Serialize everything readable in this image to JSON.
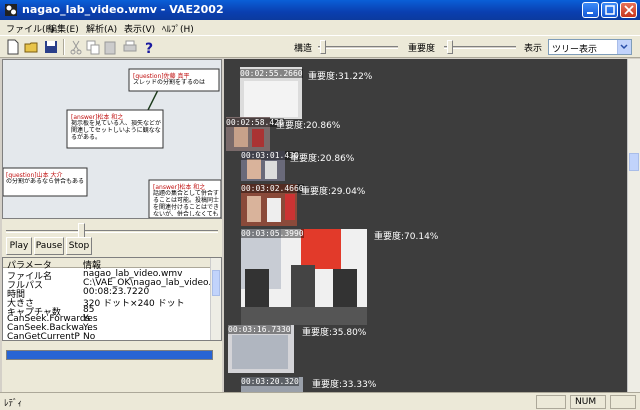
{
  "window": {
    "title": "nagao_lab_video.wmv - VAE2002"
  },
  "menu": [
    "ファイル(F)",
    "編集(E)",
    "解析(A)",
    "表示(V)",
    "ﾍﾙﾌﾟ(H)"
  ],
  "toolbar": {
    "structure_label": "構造",
    "importance_label": "重要度",
    "display_label": "表示",
    "display_value": "ツリー表示"
  },
  "player": {
    "play": "Play",
    "pause": "Pause",
    "stop": "Stop",
    "notes": [
      {
        "header": "[question]佐藤 真平",
        "body": "スレッドの分割をするのは"
      },
      {
        "header": "[answer]松本 和之",
        "body": "掲示板を見ている人、損失などが関連してセットしいように観ななるがある。"
      },
      {
        "header": "[question]山本 大介",
        "body": "の分割があるなら併合もある"
      },
      {
        "header": "[answer]松本 和之",
        "body": "話題の集合として併合することは可能。投稿同士を関連付けることはできないが、併合しなくても処理"
      }
    ]
  },
  "properties": {
    "header": [
      "パラメータ",
      "情報"
    ],
    "rows": [
      [
        "ファイル名",
        "nagao_lab_video.wmv"
      ],
      [
        "フルパス",
        "C:\\VAE_OK\\nagao_lab_video.w..."
      ],
      [
        "時間",
        "00:08:23.7220"
      ],
      [
        "大きさ",
        "320 ドット×240 ドット"
      ],
      [
        "キャプチャ数",
        "85"
      ],
      [
        "CanSeek.Forwards",
        "Yes"
      ],
      [
        "CanSeek.Backwa...",
        "Yes"
      ],
      [
        "CanGetCurrentP",
        "No"
      ]
    ],
    "progress": 1.0
  },
  "scenes": [
    {
      "time": "00:02:55.2660",
      "importance": "重要度:31.22%"
    },
    {
      "time": "00:02:58.420",
      "importance": "重要度:20.86%"
    },
    {
      "time": "00:03:01.430",
      "importance": "重要度:20.86%"
    },
    {
      "time": "00:03:02.4660",
      "importance": "重要度:29.04%"
    },
    {
      "time": "00:03:05.3990",
      "importance": "重要度:70.14%"
    },
    {
      "time": "00:03:16.7330",
      "importance": "重要度:35.80%"
    },
    {
      "time": "00:03:20.320",
      "importance": "重要度:33.33%"
    }
  ],
  "status": {
    "left": "ﾚﾃﾞｨ",
    "num": "NUM"
  }
}
